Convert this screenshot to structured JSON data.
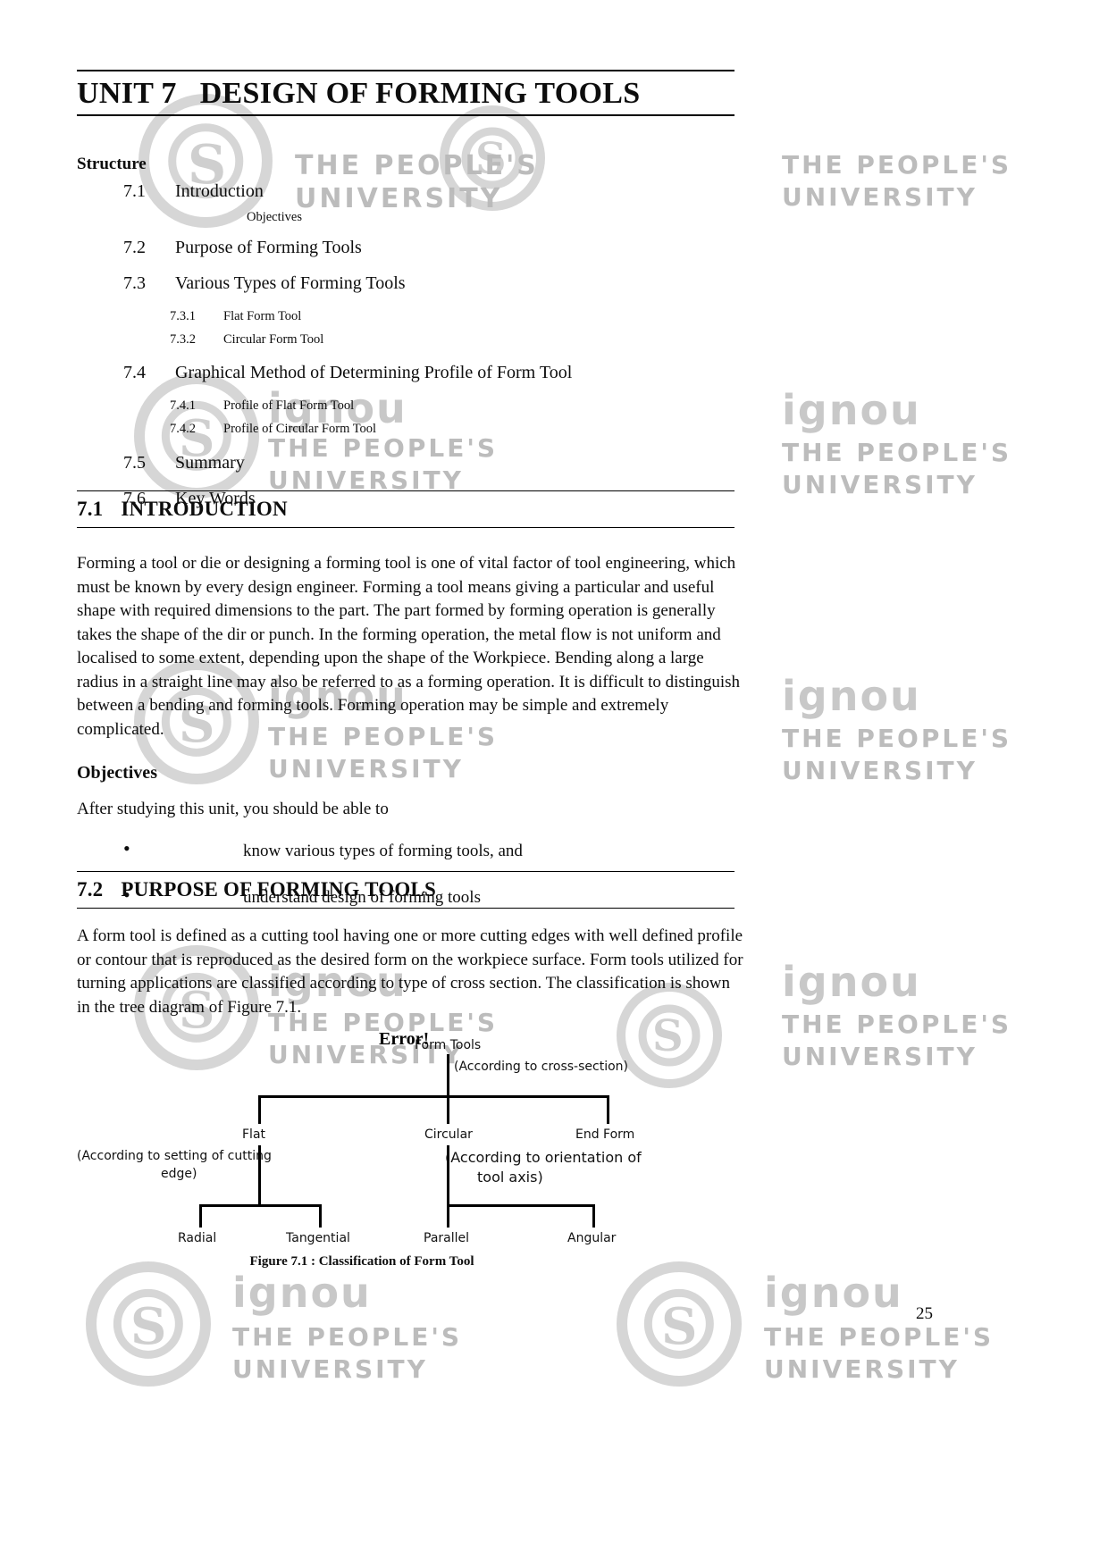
{
  "header": {
    "unit_number": "UNIT 7",
    "unit_title": "DESIGN OF FORMING TOOLS"
  },
  "structure": {
    "label": "Structure",
    "objectives_sub": "Objectives",
    "items": [
      {
        "num": "7.1",
        "label": "Introduction"
      },
      {
        "num": "7.2",
        "label": "Purpose of Forming Tools"
      },
      {
        "num": "7.3",
        "label": "Various Types of Forming Tools"
      },
      {
        "num": "7.4",
        "label": "Graphical Method of Determining Profile of Form Tool"
      },
      {
        "num": "7.5",
        "label": "Summary"
      },
      {
        "num": "7.6",
        "label": "Key Words"
      }
    ],
    "sub_73": [
      {
        "num": "7.3.1",
        "label": "Flat Form Tool"
      },
      {
        "num": "7.3.2",
        "label": "Circular Form Tool"
      }
    ],
    "sub_74": [
      {
        "num": "7.4.1",
        "label": "Profile of Flat Form Tool"
      },
      {
        "num": "7.4.2",
        "label": "Profile of Circular Form Tool"
      }
    ]
  },
  "section_71": {
    "num": "7.1",
    "title": "INTRODUCTION",
    "paragraph": "Forming a tool or die or designing a forming tool is one of vital factor of tool engineering, which must be known by every design engineer. Forming a tool means giving a particular and useful shape with required dimensions to the part. The part formed by forming operation is generally takes the shape of the dir or punch. In the forming operation, the metal flow is not uniform and localised to some extent, depending upon the shape of the Workpiece. Bending along a large radius in a straight line may also be referred to as a forming operation. It is difficult to distinguish between a bending and forming tools. Forming operation may be simple and extremely complicated.",
    "objectives_heading": "Objectives",
    "objectives_intro": "After studying this unit, you should be able to",
    "objectives_list": [
      "know various types of forming tools, and",
      "understand design of forming tools"
    ]
  },
  "section_72": {
    "num": "7.2",
    "title": "PURPOSE OF FORMING TOOLS",
    "paragraph": "A form tool is defined as a cutting tool having one or more cutting edges with well defined profile or contour that is reproduced as the desired form on the workpiece surface. Form tools utilized for turning applications are classified according to type of cross section. The classification is shown in the tree diagram of Figure 7.1."
  },
  "figure": {
    "error_text": "Error!",
    "root": "Form Tools",
    "root_note": "(According to cross-section)",
    "level1": [
      "Flat",
      "Circular",
      "End Form"
    ],
    "note_left_line1": "(According to setting of cutting",
    "note_left_line2": "edge)",
    "note_right_line1": "(According to orientation of",
    "note_right_line2": "tool axis)",
    "level2_left": [
      "Radial",
      "Tangential"
    ],
    "level2_right": [
      "Parallel",
      "Angular"
    ],
    "caption": "Figure 7.1 : Classification of Form Tool"
  },
  "page_number": "25",
  "watermark": {
    "line1": "THE PEOPLE'S",
    "line2": "UNIVERSITY",
    "brand": "ignou",
    "seal_letter": "S"
  }
}
